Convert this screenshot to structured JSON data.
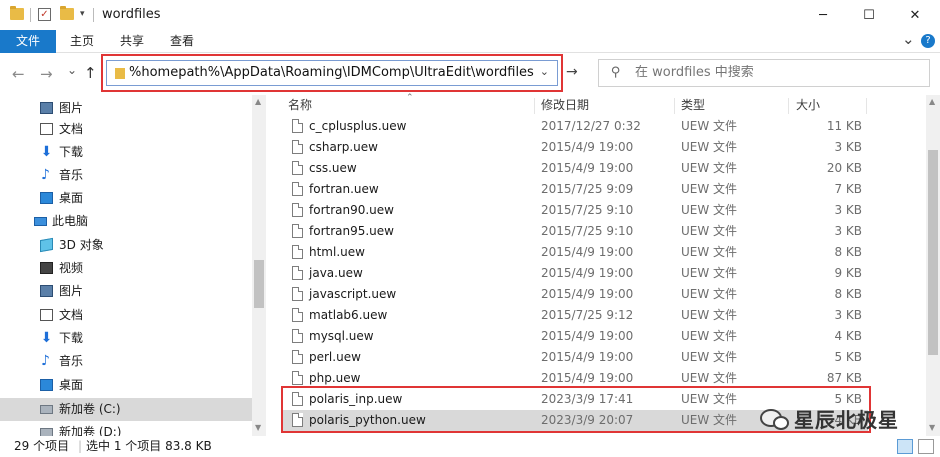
{
  "window": {
    "title": "wordfiles",
    "minimize": "─",
    "maximize": "☐",
    "close": "✕"
  },
  "ribbon": {
    "tabs": [
      "文件",
      "主页",
      "共享",
      "查看"
    ],
    "collapse": "⌄",
    "help": "?"
  },
  "nav": {
    "back": "←",
    "forward": "→",
    "recent": "⌄",
    "up": "↑"
  },
  "address": {
    "path": "%homepath%\\AppData\\Roaming\\IDMComp\\UltraEdit\\wordfiles",
    "dropdown": "⌄",
    "go": "→"
  },
  "search": {
    "placeholder": "在 wordfiles 中搜索"
  },
  "navpane": {
    "items": [
      {
        "label": "图片",
        "icon": "pictures-icon"
      },
      {
        "label": "文档",
        "icon": "documents-icon"
      },
      {
        "label": "下载",
        "icon": "downloads-icon"
      },
      {
        "label": "音乐",
        "icon": "music-icon"
      },
      {
        "label": "桌面",
        "icon": "desktop-icon"
      },
      {
        "label": "此电脑",
        "icon": "this-pc-icon"
      },
      {
        "label": "3D 对象",
        "icon": "3d-objects-icon"
      },
      {
        "label": "视频",
        "icon": "videos-icon"
      },
      {
        "label": "图片",
        "icon": "pictures-icon"
      },
      {
        "label": "文档",
        "icon": "documents-icon"
      },
      {
        "label": "下载",
        "icon": "downloads-icon"
      },
      {
        "label": "音乐",
        "icon": "music-icon"
      },
      {
        "label": "桌面",
        "icon": "desktop-icon"
      },
      {
        "label": "新加卷 (C:)",
        "icon": "drive-icon"
      },
      {
        "label": "新加卷 (D:)",
        "icon": "drive-icon"
      }
    ]
  },
  "columns": {
    "name": "名称",
    "date": "修改日期",
    "type": "类型",
    "size": "大小"
  },
  "files": [
    {
      "name": "c_cplusplus.uew",
      "date": "2017/12/27 0:32",
      "type": "UEW 文件",
      "size": "11 KB"
    },
    {
      "name": "csharp.uew",
      "date": "2015/4/9 19:00",
      "type": "UEW 文件",
      "size": "3 KB"
    },
    {
      "name": "css.uew",
      "date": "2015/4/9 19:00",
      "type": "UEW 文件",
      "size": "20 KB"
    },
    {
      "name": "fortran.uew",
      "date": "2015/7/25 9:09",
      "type": "UEW 文件",
      "size": "7 KB"
    },
    {
      "name": "fortran90.uew",
      "date": "2015/7/25 9:10",
      "type": "UEW 文件",
      "size": "3 KB"
    },
    {
      "name": "fortran95.uew",
      "date": "2015/7/25 9:10",
      "type": "UEW 文件",
      "size": "3 KB"
    },
    {
      "name": "html.uew",
      "date": "2015/4/9 19:00",
      "type": "UEW 文件",
      "size": "8 KB"
    },
    {
      "name": "java.uew",
      "date": "2015/4/9 19:00",
      "type": "UEW 文件",
      "size": "9 KB"
    },
    {
      "name": "javascript.uew",
      "date": "2015/4/9 19:00",
      "type": "UEW 文件",
      "size": "8 KB"
    },
    {
      "name": "matlab6.uew",
      "date": "2015/7/25 9:12",
      "type": "UEW 文件",
      "size": "3 KB"
    },
    {
      "name": "mysql.uew",
      "date": "2015/4/9 19:00",
      "type": "UEW 文件",
      "size": "4 KB"
    },
    {
      "name": "perl.uew",
      "date": "2015/4/9 19:00",
      "type": "UEW 文件",
      "size": "5 KB"
    },
    {
      "name": "php.uew",
      "date": "2015/4/9 19:00",
      "type": "UEW 文件",
      "size": "87 KB"
    },
    {
      "name": "polaris_inp.uew",
      "date": "2023/3/9 17:41",
      "type": "UEW 文件",
      "size": "5 KB"
    },
    {
      "name": "polaris_python.uew",
      "date": "2023/3/9 20:07",
      "type": "UEW 文件",
      "size": "4 KB"
    }
  ],
  "status": {
    "count": "29 个项目",
    "selected": "选中 1 个项目  83.8 KB"
  },
  "watermark": {
    "text": "星辰北极星"
  },
  "colors": {
    "file_tab": "#1979ca",
    "highlight": "#e03535",
    "selected_row": "#d9d9d9"
  }
}
